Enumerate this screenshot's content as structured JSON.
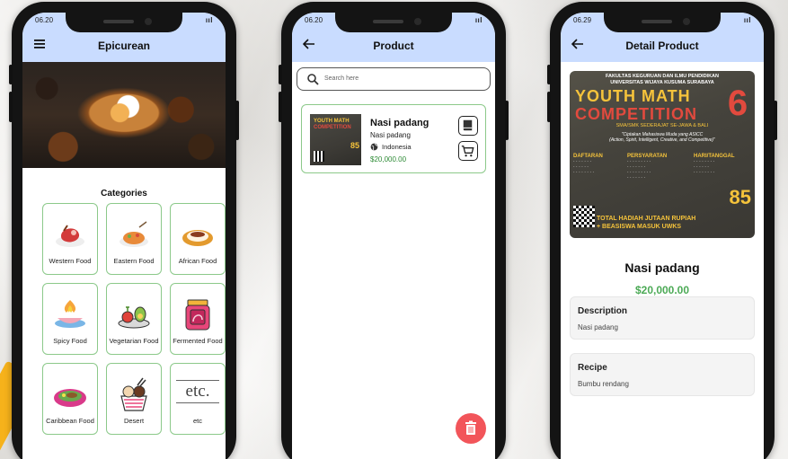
{
  "phones": {
    "home": {
      "status_time": "06.20",
      "status_right": "ııl",
      "title": "Epicurean",
      "section_title": "Categories",
      "categories": [
        {
          "label": "Western Food"
        },
        {
          "label": "Eastern Food"
        },
        {
          "label": "African Food"
        },
        {
          "label": "Spicy Food"
        },
        {
          "label": "Vegetarian Food"
        },
        {
          "label": "Fermented Food"
        },
        {
          "label": "Caribbean Food"
        },
        {
          "label": "Desert"
        },
        {
          "label": "etc"
        }
      ],
      "etc_logo_text": "etc."
    },
    "product": {
      "status_time": "06.20",
      "status_right": "ııl",
      "title": "Product",
      "search_placeholder": "Search here",
      "item": {
        "name": "Nasi padang",
        "description": "Nasi padang",
        "origin": "Indonesia",
        "price": "$20,000.00"
      }
    },
    "detail": {
      "status_time": "06.29",
      "status_right": "ııl",
      "title": "Detail Product",
      "name": "Nasi padang",
      "price": "$20,000.00",
      "description_label": "Description",
      "description_value": "Nasi padang",
      "recipe_label": "Recipe",
      "recipe_value": "Bumbu rendang",
      "poster": {
        "header": "FAKULTAS KEGURUAN DAN ILMU PENDIDIKAN\nUNIVERSITAS WIJAYA KUSUMA SURABAYA",
        "title_line1": "YOUTH MATH",
        "title_line2": "COMPETITION",
        "edition": "6",
        "subtitle": "SMA/SMK SEDERAJAT SE-JAWA & BALI",
        "quote": "\"Ciptakan Mahasiswa Muda yang ASICC\n(Action, Spirit, Intelligent, Creative, and Competitive)\"",
        "col1_title": "DAFTARAN",
        "col2_title": "PERSYARATAN",
        "col3_title": "HARI/TANGGAL",
        "big_number": "85",
        "prize_line1": "TOTAL HADIAH JUTAAN RUPIAH",
        "prize_line2": "+ BEASISWA MASUK UWKS"
      }
    }
  },
  "colors": {
    "appbar": "#c9dcff",
    "border_green": "#8cc98a",
    "price_green": "#2e8b36",
    "fab_red": "#f2555a"
  },
  "icons": [
    "menu-icon",
    "back-arrow-icon",
    "search-icon",
    "globe-icon",
    "book-icon",
    "cart-icon",
    "trash-icon"
  ]
}
